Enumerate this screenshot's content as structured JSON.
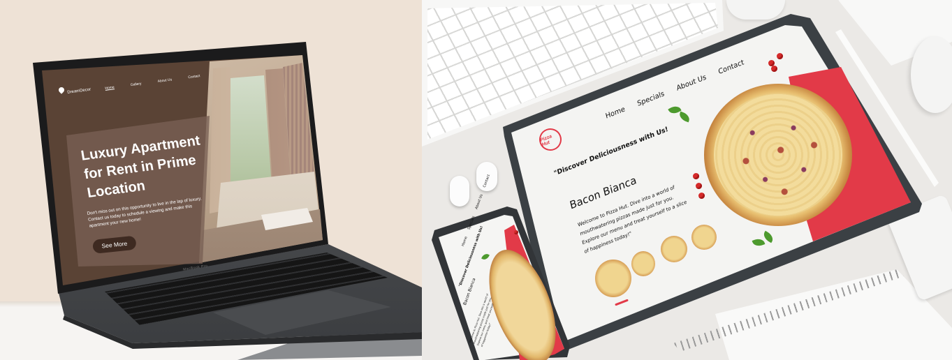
{
  "laptop_site": {
    "brand": "DreamDecor",
    "nav": [
      "Home",
      "Gallery",
      "About Us",
      "Contact"
    ],
    "headline": "Luxury Apartment for Rent in Prime Location",
    "description": "Don't miss out on this opportunity to live in the lap of luxury. Contact us today to schedule a viewing and make this apartment your new home!",
    "cta_label": "See More",
    "device_label": "MacBook Pro"
  },
  "tablet_site": {
    "logo_text": "Pizza Hut",
    "nav": [
      "Home",
      "Specials",
      "About Us",
      "Contact"
    ],
    "tagline": "\"Discover Deliciousness with Us!",
    "title": "Bacon Bianca",
    "description_lines": [
      "Welcome to Pizza Hut. Dive into a world of",
      "mouthwatering pizzas made just for you.",
      "Explore our menu and treat yourself to a slice",
      "of happiness today!\""
    ]
  },
  "phone_site": {
    "nav": [
      "Home",
      "Specials",
      "About Us",
      "Contact"
    ],
    "tagline": "\"Discover Deliciousness with Us!",
    "title": "Bacon Bianca",
    "description_lines": [
      "Welcome to Pizza Hut. Dive into a world of",
      "mouthwatering pizzas made just for you.",
      "Explore our menu and treat yourself",
      "of happiness today!\""
    ]
  },
  "colors": {
    "brown_accent": "#5a4335",
    "pizza_red": "#e23a48",
    "button_dark": "#3e2a21"
  }
}
